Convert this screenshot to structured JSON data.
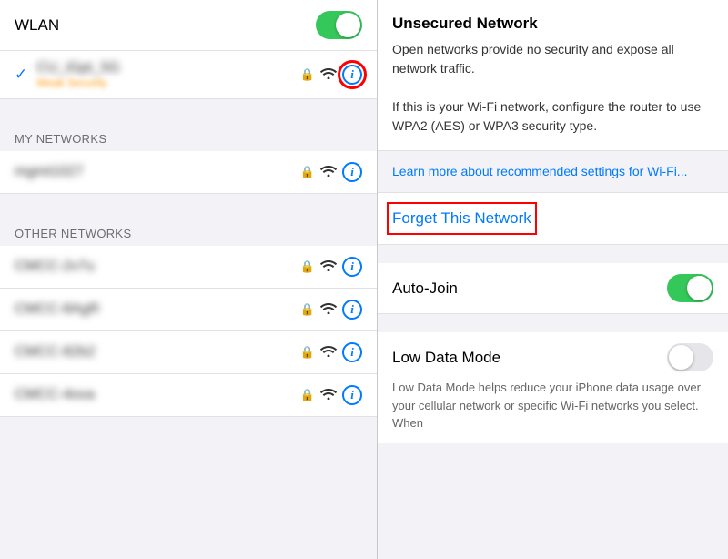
{
  "left": {
    "wlan_label": "WLAN",
    "connected_network": {
      "name": "CU_iGpt_5G",
      "subtitle": "Weak Security"
    },
    "my_networks": {
      "header": "MY NETWORKS",
      "items": [
        {
          "name": "mgmt1027"
        }
      ]
    },
    "other_networks": {
      "header": "OTHER NETWORKS",
      "items": [
        {
          "name": "CMCC-2v7u"
        },
        {
          "name": "CMCC-8AgR"
        },
        {
          "name": "CMCC-82b2"
        },
        {
          "name": "CMCC-4ova"
        }
      ]
    }
  },
  "right": {
    "unsecured_title": "Unsecured Network",
    "unsecured_desc": "Open networks provide no security and expose all network traffic.\n\nIf this is your Wi-Fi network, configure the router to use WPA2 (AES) or WPA3 security type.",
    "learn_more": "Learn more about recommended settings for Wi-Fi...",
    "forget_label": "Forget This Network",
    "auto_join_label": "Auto-Join",
    "low_data_label": "Low Data Mode",
    "low_data_desc": "Low Data Mode helps reduce your iPhone data usage over your cellular network or specific Wi-Fi networks you select. When"
  },
  "icons": {
    "lock": "🔒",
    "wifi": "📶",
    "info": "i",
    "check": "✓"
  }
}
